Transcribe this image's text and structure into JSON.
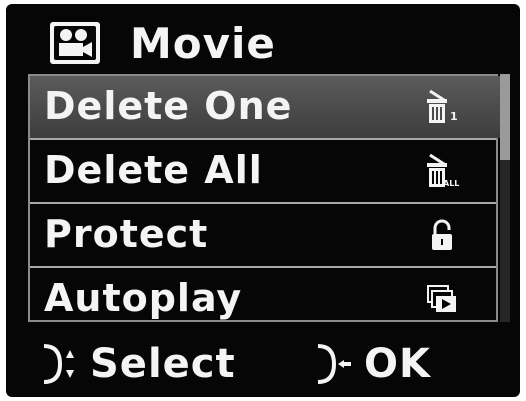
{
  "header": {
    "title": "Movie",
    "icon": "movie-camera-icon"
  },
  "menu": {
    "items": [
      {
        "label": "Delete One",
        "icon": "delete-one-icon",
        "selected": true
      },
      {
        "label": "Delete All",
        "icon": "delete-all-icon",
        "selected": false
      },
      {
        "label": "Protect",
        "icon": "lock-icon",
        "selected": false
      },
      {
        "label": "Autoplay",
        "icon": "slideshow-icon",
        "selected": false
      }
    ]
  },
  "footer": {
    "select_label": "Select",
    "select_icon": "dpad-up-down-icon",
    "ok_label": "OK",
    "ok_icon": "dpad-enter-icon"
  },
  "colors": {
    "background": "#060606",
    "text": "#f4f4f4",
    "selected_row": "#4a4a4a",
    "border": "#8a8a8a"
  }
}
